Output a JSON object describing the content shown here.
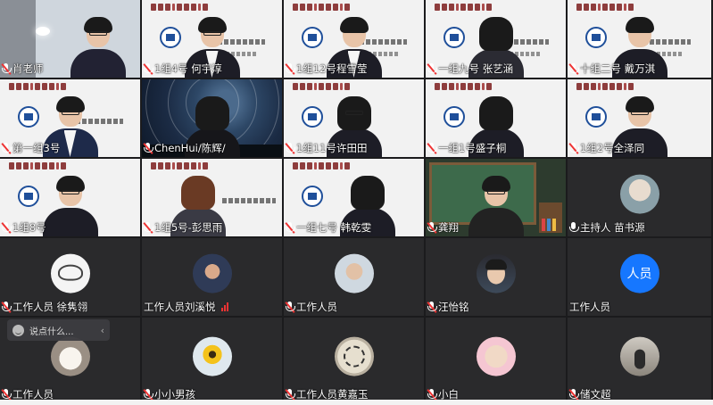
{
  "participants": [
    {
      "name": "肖老师",
      "muted": true
    },
    {
      "name": "1组4号 何宇淳",
      "muted": true
    },
    {
      "name": "1组12号程雪莹",
      "muted": true
    },
    {
      "name": "一组九号 张艺涵",
      "muted": true
    },
    {
      "name": "十组二号 戴万淇",
      "muted": true
    },
    {
      "name": "第一组3号",
      "muted": true
    },
    {
      "name": "ChenHui/陈辉/",
      "muted": true
    },
    {
      "name": "1组11号许田田",
      "muted": true
    },
    {
      "name": "一组1号盛子桐",
      "muted": true
    },
    {
      "name": "1组2号全泽同",
      "muted": true
    },
    {
      "name": "1组8号",
      "muted": true
    },
    {
      "name": "1组5号-彭思雨",
      "muted": true
    },
    {
      "name": "一组七号 韩乾雯",
      "muted": true
    },
    {
      "name": "龚翔",
      "muted": true
    },
    {
      "name": "主持人  苗书源",
      "muted": false
    },
    {
      "name": "工作人员  徐隽翎",
      "muted": true
    },
    {
      "name": "工作人员刘溪悦",
      "muted": false
    },
    {
      "name": "工作人员",
      "muted": true
    },
    {
      "name": "汪怡铭",
      "muted": true
    },
    {
      "name": "工作人员",
      "muted": false
    },
    {
      "name": "工作人员",
      "muted": true
    },
    {
      "name": "小小男孩",
      "muted": true
    },
    {
      "name": "工作人员黄嘉玉",
      "muted": true
    },
    {
      "name": "小白",
      "muted": true
    },
    {
      "name": "储文超",
      "muted": true
    }
  ],
  "avatar_text": "人员",
  "chat": {
    "placeholder": "说点什么..."
  },
  "colors": {
    "accent": "#1677ff",
    "muted": "#e33333"
  }
}
